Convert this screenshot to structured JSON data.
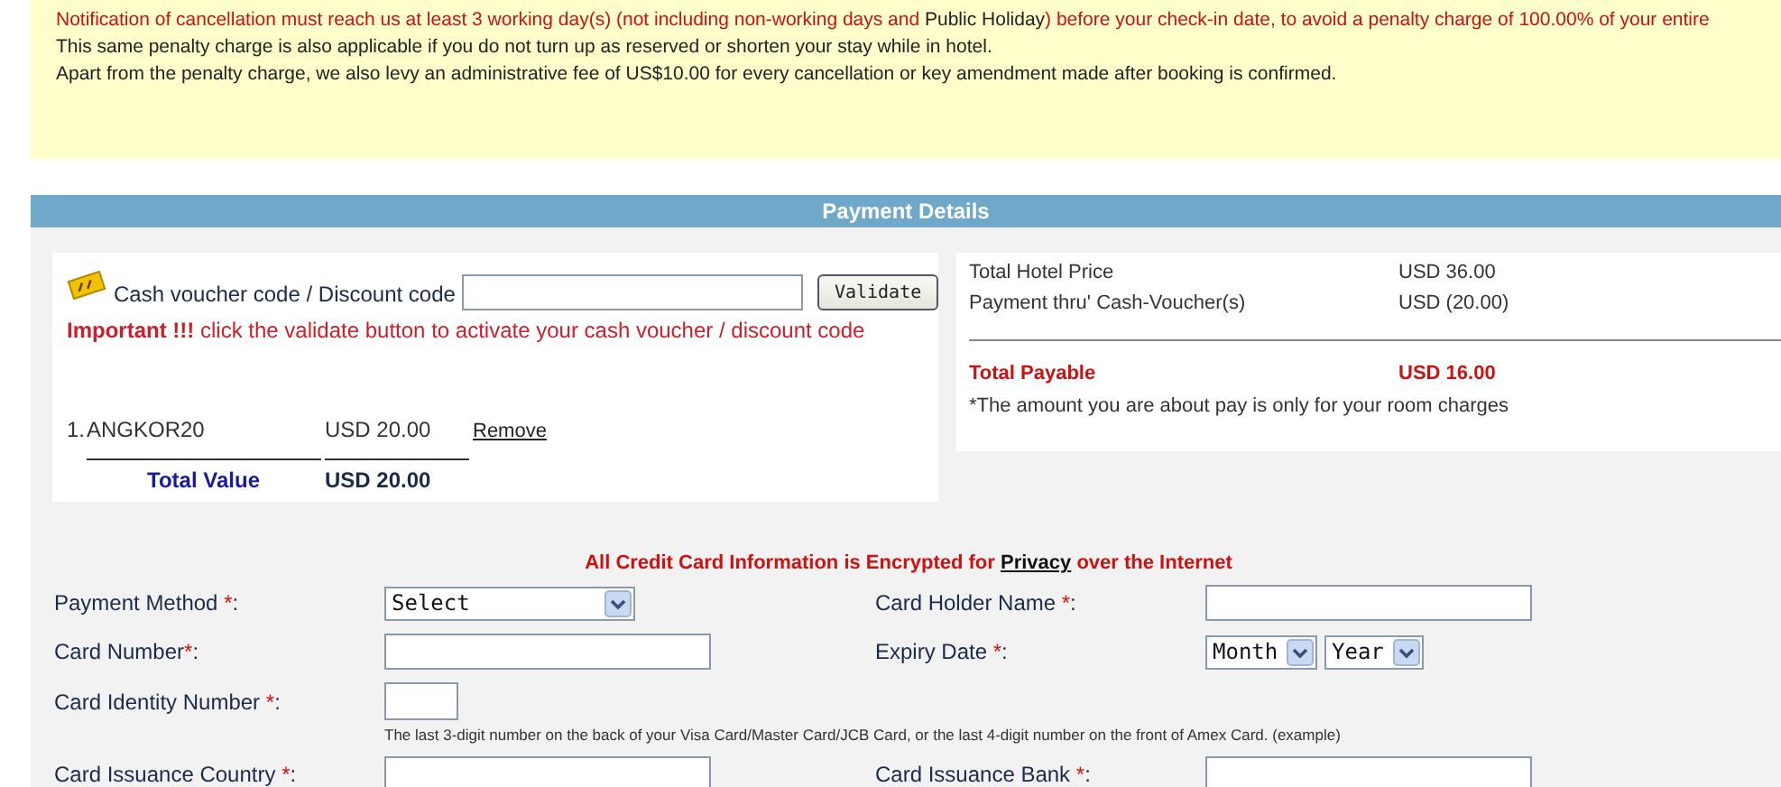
{
  "notice": {
    "lines": [
      {
        "segments": [
          {
            "text": "Notification of cancellation must reach us at least 3 working day(s) (not including non-working days and ",
            "warning": true
          },
          {
            "text": "Public Holiday",
            "warning": false
          },
          {
            "text": ") before your check-in date, to avoid a penalty charge of 100.00% of your entire",
            "warning": true
          }
        ]
      },
      {
        "segments": [
          {
            "text": "This same penalty charge is also applicable if you do not turn up as reserved or shorten your stay while in hotel.",
            "warning": false
          }
        ]
      },
      {
        "segments": [
          {
            "text": "Apart from the penalty charge, we also levy an administrative fee of US$10.00 for every cancellation or key amendment made after booking is confirmed.",
            "warning": false
          }
        ]
      }
    ]
  },
  "payment": {
    "title": "Payment Details",
    "voucher": {
      "label": "Cash voucher code / Discount code",
      "button": "Validate",
      "important": "**Important !!!** click the validate button to activate your cash voucher / discount code",
      "items": [
        {
          "index": "1.",
          "code": "ANGKOR20",
          "amount": "USD 20.00",
          "action": "Remove"
        }
      ],
      "total": {
        "label": "Total Value",
        "value": "USD 20.00"
      }
    },
    "summary": {
      "rows": [
        {
          "label": "Total Hotel Price",
          "value": "USD 36.00"
        },
        {
          "label": "Payment thru' Cash-Voucher(s)",
          "value": "USD (20.00)"
        }
      ],
      "total": {
        "label": "Total Payable",
        "value": "USD 16.00"
      },
      "note": "*The amount you are about pay is only for your room charges"
    }
  },
  "card": {
    "notice": {
      "before": "All Credit Card Information is Encrypted for ",
      "link": "Privacy",
      "after": " over the Internet"
    },
    "rows": [
      {
        "left": {
          "label": "Payment Method ",
          "mark": "*",
          "suffix": ":",
          "kind": "select",
          "options": [
            "Select"
          ]
        },
        "right": {
          "label": "Card Holder Name ",
          "mark": "*",
          "suffix": ":",
          "kind": "text"
        }
      },
      {
        "left": {
          "label": "Card Number",
          "mark": "*",
          "suffix": ":",
          "kind": "text"
        },
        "right": {
          "label": "Expiry Date ",
          "mark": "*",
          "suffix": ":",
          "kind": "date",
          "options": [
            "Month",
            "Year"
          ]
        }
      },
      {
        "left": {
          "label": "Card Identity Number ",
          "mark": "*",
          "suffix": ":",
          "kind": "short",
          "hint": "The last 3-digit number on the back of your Visa Card/Master Card/JCB Card, or the last 4-digit number on the front of Amex Card. (example)"
        }
      },
      {
        "left": {
          "label": "Card Issuance Country ",
          "mark": "*",
          "suffix": ":",
          "kind": "text"
        },
        "right": {
          "label": "Card Issuance Bank ",
          "mark": "*",
          "suffix": ":",
          "kind": "text"
        }
      }
    ]
  }
}
